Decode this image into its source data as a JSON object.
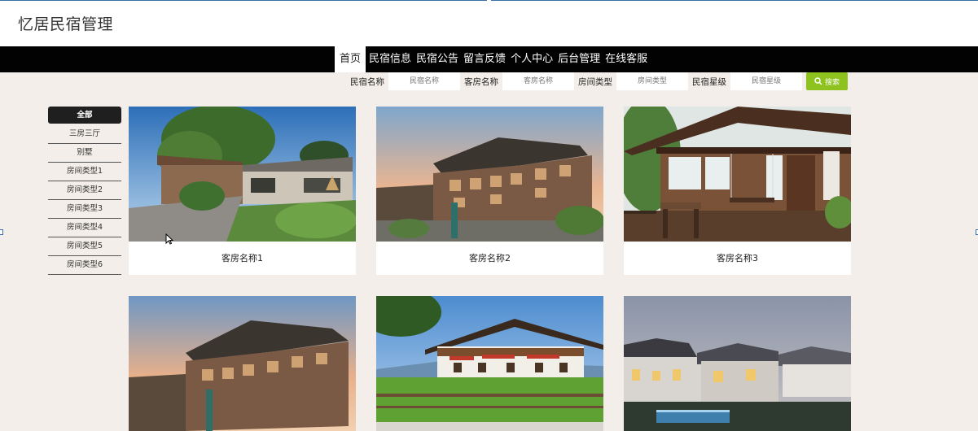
{
  "site": {
    "title": "忆居民宿管理"
  },
  "nav": {
    "items": [
      {
        "label": "首页",
        "active": true
      },
      {
        "label": "民宿信息"
      },
      {
        "label": "民宿公告"
      },
      {
        "label": "留言反馈"
      },
      {
        "label": "个人中心"
      },
      {
        "label": "后台管理"
      },
      {
        "label": "在线客服"
      }
    ]
  },
  "search": {
    "fields": [
      {
        "label": "民宿名称",
        "placeholder": "民宿名称"
      },
      {
        "label": "客房名称",
        "placeholder": "客房名称"
      },
      {
        "label": "房间类型",
        "placeholder": "房间类型"
      },
      {
        "label": "民宿星级",
        "placeholder": "民宿星级"
      }
    ],
    "button_label": "搜索",
    "button_icon": "search-icon",
    "accent": "#8dc21f"
  },
  "sidebar": {
    "items": [
      {
        "label": "全部",
        "active": true
      },
      {
        "label": "三房三厅"
      },
      {
        "label": "别墅"
      },
      {
        "label": "房间类型1"
      },
      {
        "label": "房间类型2"
      },
      {
        "label": "房间类型3"
      },
      {
        "label": "房间类型4"
      },
      {
        "label": "房间类型5"
      },
      {
        "label": "房间类型6"
      }
    ]
  },
  "rooms": [
    {
      "name": "客房名称1",
      "image": "courtyard-house-photo"
    },
    {
      "name": "客房名称2",
      "image": "wooden-guesthouse-photo"
    },
    {
      "name": "客房名称3",
      "image": "porch-swing-cabin-photo"
    },
    {
      "image": "wooden-guesthouse-photo"
    },
    {
      "image": "alpine-chalet-photo"
    },
    {
      "image": "dusk-villas-photo"
    }
  ],
  "colors": {
    "navbar": "#020202",
    "page_bg": "#f3eee9"
  }
}
